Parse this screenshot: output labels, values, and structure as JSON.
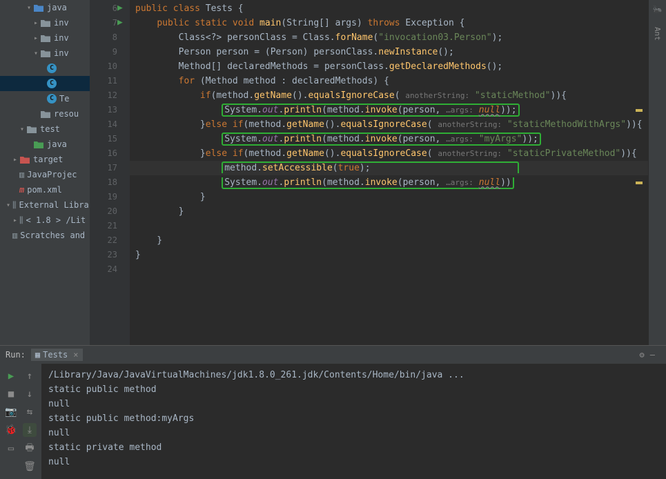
{
  "sidebar": {
    "items": [
      {
        "indent": 3,
        "arrow": "▾",
        "color": "blue",
        "label": "java"
      },
      {
        "indent": 4,
        "arrow": "▸",
        "color": "gray",
        "label": "inv"
      },
      {
        "indent": 4,
        "arrow": "▸",
        "color": "gray",
        "label": "inv"
      },
      {
        "indent": 4,
        "arrow": "▾",
        "color": "gray",
        "label": "inv"
      },
      {
        "indent": 5,
        "arrow": "",
        "icon": "class",
        "label": ""
      },
      {
        "indent": 5,
        "arrow": "",
        "icon": "class",
        "label": "",
        "selected": true
      },
      {
        "indent": 5,
        "arrow": "",
        "icon": "class",
        "label": "Te"
      },
      {
        "indent": 4,
        "arrow": "",
        "color": "gray",
        "label": "resou"
      },
      {
        "indent": 2,
        "arrow": "▾",
        "color": "gray",
        "label": "test"
      },
      {
        "indent": 3,
        "arrow": "",
        "color": "green",
        "label": "java"
      },
      {
        "indent": 1,
        "arrow": "▸",
        "color": "red",
        "label": "target"
      },
      {
        "indent": 1,
        "arrow": "",
        "icon": "file",
        "label": "JavaProjec"
      },
      {
        "indent": 1,
        "arrow": "",
        "icon": "maven",
        "label": "pom.xml"
      },
      {
        "indent": 0,
        "arrow": "▾",
        "icon": "lib",
        "label": "External Libra"
      },
      {
        "indent": 1,
        "arrow": "▸",
        "icon": "lib",
        "label": "< 1.8 > /Lit"
      },
      {
        "indent": 0,
        "arrow": "",
        "icon": "scratch",
        "label": "Scratches and"
      }
    ]
  },
  "lines": {
    "start": 6,
    "end": 24
  },
  "code": {
    "l6": {
      "kw1": "public",
      "kw2": "class",
      "name": "Tests"
    },
    "l7": {
      "kw1": "public",
      "kw2": "static",
      "kw3": "void",
      "name": "main",
      "p1": "String",
      "p2": "args",
      "kw4": "throws",
      "exc": "Exception"
    },
    "l8": {
      "t1": "Class",
      "t2": "personClass",
      "t3": "Class",
      "m": "forName",
      "s": "\"invocation03.Person\""
    },
    "l9": {
      "t1": "Person",
      "t2": "person",
      "t3": "Person",
      "v": "personClass",
      "m": "newInstance"
    },
    "l10": {
      "t1": "Method",
      "v": "declaredMethods",
      "p": "personClass",
      "m": "getDeclaredMethods"
    },
    "l11": {
      "kw": "for",
      "t": "Method",
      "v": "method",
      "a": "declaredMethods"
    },
    "l12": {
      "kw": "if",
      "v": "method",
      "m1": "getName",
      "m2": "equalsIgnoreCase",
      "h": "anotherString:",
      "s": "\"staticMethod\""
    },
    "l13": {
      "c1": "System",
      "f": "out",
      "m1": "println",
      "v": "method",
      "m2": "invoke",
      "p": "person",
      "h": "…args:",
      "n": "null"
    },
    "l14": {
      "kw1": "else",
      "kw2": "if",
      "v": "method",
      "m1": "getName",
      "m2": "equalsIgnoreCase",
      "h": "anotherString:",
      "s": "\"staticMethodWithArgs\""
    },
    "l15": {
      "c1": "System",
      "f": "out",
      "m1": "println",
      "v": "method",
      "m2": "invoke",
      "p": "person",
      "h": "…args:",
      "s": "\"myArgs\""
    },
    "l16": {
      "kw1": "else",
      "kw2": "if",
      "v": "method",
      "m1": "getName",
      "m2": "equalsIgnoreCase",
      "h": "anotherString:",
      "s": "\"staticPrivateMethod\""
    },
    "l17": {
      "v": "method",
      "m": "setAccessible",
      "t": "true"
    },
    "l18": {
      "c1": "System",
      "f": "out",
      "m1": "println",
      "v": "method",
      "m2": "invoke",
      "p": "person",
      "h": "…args:",
      "n": "null"
    }
  },
  "run": {
    "label": "Run:",
    "tab": "Tests",
    "output": [
      "/Library/Java/JavaVirtualMachines/jdk1.8.0_261.jdk/Contents/Home/bin/java ...",
      "static public method",
      "null",
      "static public method:myArgs",
      "null",
      "static private method",
      "null"
    ]
  },
  "rside": {
    "ant": "Ant"
  }
}
